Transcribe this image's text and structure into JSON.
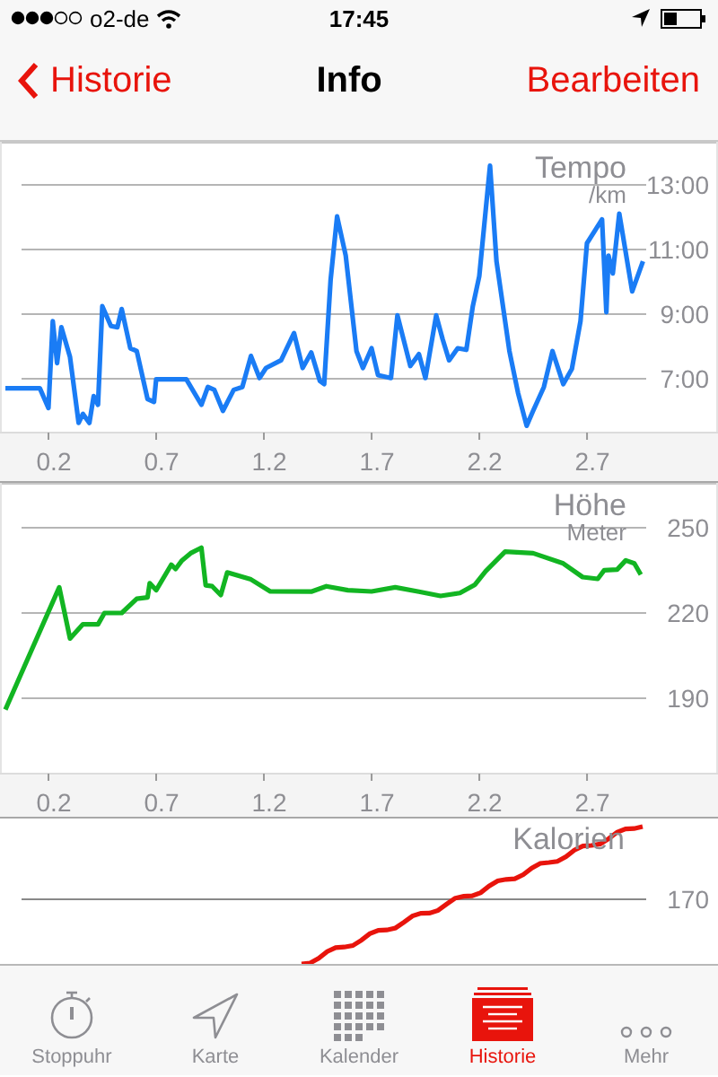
{
  "status_bar": {
    "carrier": "o2-de",
    "time": "17:45"
  },
  "nav": {
    "back": "Historie",
    "title": "Info",
    "action": "Bearbeiten"
  },
  "charts": [
    {
      "chart_data": {
        "type": "line",
        "title": "Tempo",
        "ylabel": "/km",
        "grid": true,
        "xlim": [
          -0.025,
          3.308
        ],
        "ylim": [
          5.33,
          14.33
        ],
        "xticks": [
          0.2,
          0.7,
          1.2,
          1.7,
          2.2,
          2.7
        ],
        "yticks": [
          {
            "value": 7,
            "label": "7:00"
          },
          {
            "value": 9,
            "label": "9:00"
          },
          {
            "value": 11,
            "label": "11:00"
          },
          {
            "value": 13,
            "label": "13:00"
          }
        ],
        "x": [
          0,
          0.16,
          0.2,
          0.22,
          0.24,
          0.26,
          0.3,
          0.34,
          0.36,
          0.39,
          0.41,
          0.43,
          0.45,
          0.49,
          0.52,
          0.54,
          0.58,
          0.61,
          0.66,
          0.69,
          0.7,
          0.84,
          0.91,
          0.94,
          0.97,
          1.01,
          1.06,
          1.1,
          1.14,
          1.18,
          1.21,
          1.28,
          1.34,
          1.38,
          1.42,
          1.46,
          1.48,
          1.51,
          1.54,
          1.58,
          1.63,
          1.66,
          1.7,
          1.73,
          1.79,
          1.82,
          1.88,
          1.92,
          1.95,
          2.0,
          2.03,
          2.06,
          2.1,
          2.14,
          2.17,
          2.2,
          2.25,
          2.28,
          2.34,
          2.38,
          2.42,
          2.45,
          2.5,
          2.54,
          2.59,
          2.63,
          2.67,
          2.7,
          2.77,
          2.79,
          2.8,
          2.82,
          2.85,
          2.91,
          2.96
        ],
        "series": [
          {
            "color": "#1a7cf5",
            "values": [
              6.7,
              6.7,
              6.09,
              8.78,
              7.48,
              8.59,
              7.67,
              5.63,
              5.91,
              5.63,
              6.46,
              6.19,
              9.24,
              8.63,
              8.59,
              9.15,
              7.94,
              7.85,
              6.37,
              6.28,
              6.98,
              6.98,
              6.19,
              6.74,
              6.65,
              6.0,
              6.65,
              6.74,
              7.7,
              7.02,
              7.33,
              7.57,
              8.41,
              7.33,
              7.81,
              6.93,
              6.83,
              10.07,
              12.02,
              10.81,
              7.85,
              7.33,
              7.94,
              7.11,
              7.02,
              8.96,
              7.39,
              7.76,
              7.02,
              8.96,
              8.22,
              7.57,
              7.94,
              7.89,
              9.24,
              10.17,
              13.59,
              10.63,
              7.85,
              6.56,
              5.54,
              6.0,
              6.74,
              7.85,
              6.83,
              7.3,
              8.78,
              11.19,
              11.93,
              9.06,
              10.81,
              10.26,
              12.11,
              9.7,
              10.63
            ]
          }
        ]
      }
    },
    {
      "chart_data": {
        "type": "line",
        "title": "Höhe",
        "ylabel": "Meter",
        "grid": true,
        "xlim": [
          -0.025,
          3.308
        ],
        "ylim": [
          163.47,
          265.79
        ],
        "xticks": [
          0.2,
          0.7,
          1.2,
          1.7,
          2.2,
          2.7
        ],
        "yticks": [
          190,
          220,
          250
        ],
        "x": [
          0,
          0.25,
          0.3,
          0.36,
          0.43,
          0.46,
          0.54,
          0.61,
          0.66,
          0.67,
          0.7,
          0.77,
          0.79,
          0.82,
          0.86,
          0.91,
          0.93,
          0.96,
          1.0,
          1.03,
          1.14,
          1.23,
          1.42,
          1.49,
          1.59,
          1.7,
          1.81,
          1.92,
          2.02,
          2.11,
          2.18,
          2.23,
          2.32,
          2.45,
          2.59,
          2.68,
          2.75,
          2.78,
          2.84,
          2.88,
          2.92,
          2.95
        ],
        "series": [
          {
            "color": "#12b522",
            "values": [
              186,
              229,
              211,
              216,
              216,
              220,
              220,
              225,
              225.5,
              230.5,
              228,
              237,
              235.5,
              238.5,
              241,
              243,
              229.7,
              229.4,
              226.3,
              234.3,
              231.8,
              227.6,
              227.5,
              229.4,
              228,
              227.6,
              229,
              227.5,
              226,
              227,
              230,
              234.7,
              241.6,
              241,
              237.4,
              232.6,
              232,
              235,
              235.3,
              238.5,
              237.4,
              233.5
            ]
          }
        ]
      }
    }
  ],
  "calories": {
    "title": "Kalorien",
    "tick": "170"
  },
  "tabs": [
    {
      "label": "Stoppuhr",
      "selected": false
    },
    {
      "label": "Karte",
      "selected": false
    },
    {
      "label": "Kalender",
      "selected": false
    },
    {
      "label": "Historie",
      "selected": true
    },
    {
      "label": "Mehr",
      "selected": false
    }
  ]
}
